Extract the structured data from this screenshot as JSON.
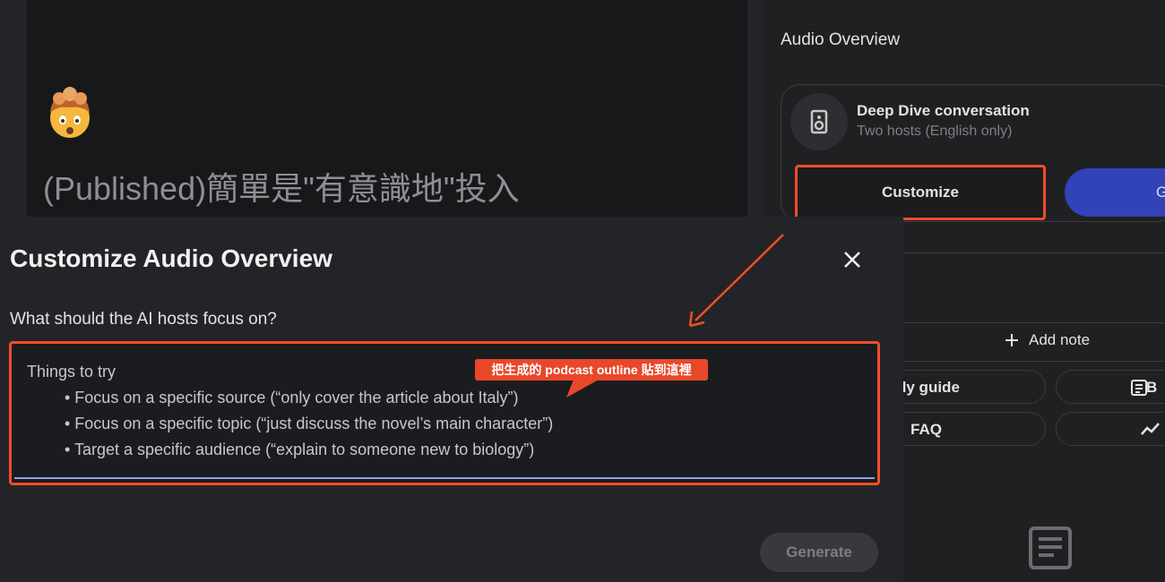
{
  "document": {
    "title": "(Published)簡單是\"有意識地\"投入"
  },
  "audio_panel": {
    "title": "Audio Overview",
    "deep_dive_title": "Deep Dive conversation",
    "deep_dive_subtitle": "Two hosts (English only)",
    "customize_label": "Customize",
    "generate_partial_label": "G",
    "add_note_label": "Add note",
    "chips": [
      "dy guide",
      "B",
      "FAQ"
    ]
  },
  "dialog": {
    "title": "Customize Audio Overview",
    "question": "What should the AI hosts focus on?",
    "placeholder_heading": "Things to try",
    "bullets": [
      "• Focus on a specific source (“only cover the article about Italy”)",
      "• Focus on a specific topic (“just discuss the novel’s main character”)",
      "• Target a specific audience (“explain to someone new to biology”)"
    ],
    "generate_label": "Generate"
  },
  "annotation": {
    "callout_text": "把生成的 podcast outline 貼到這裡",
    "accent_color": "#f04e2a"
  },
  "icons": {
    "emoji": "exploding-head-icon",
    "speaker": "speaker-icon",
    "close": "close-icon",
    "plus": "plus-icon",
    "study_guide": "study-guide-icon",
    "timeline": "timeline-icon",
    "note": "document-icon"
  }
}
